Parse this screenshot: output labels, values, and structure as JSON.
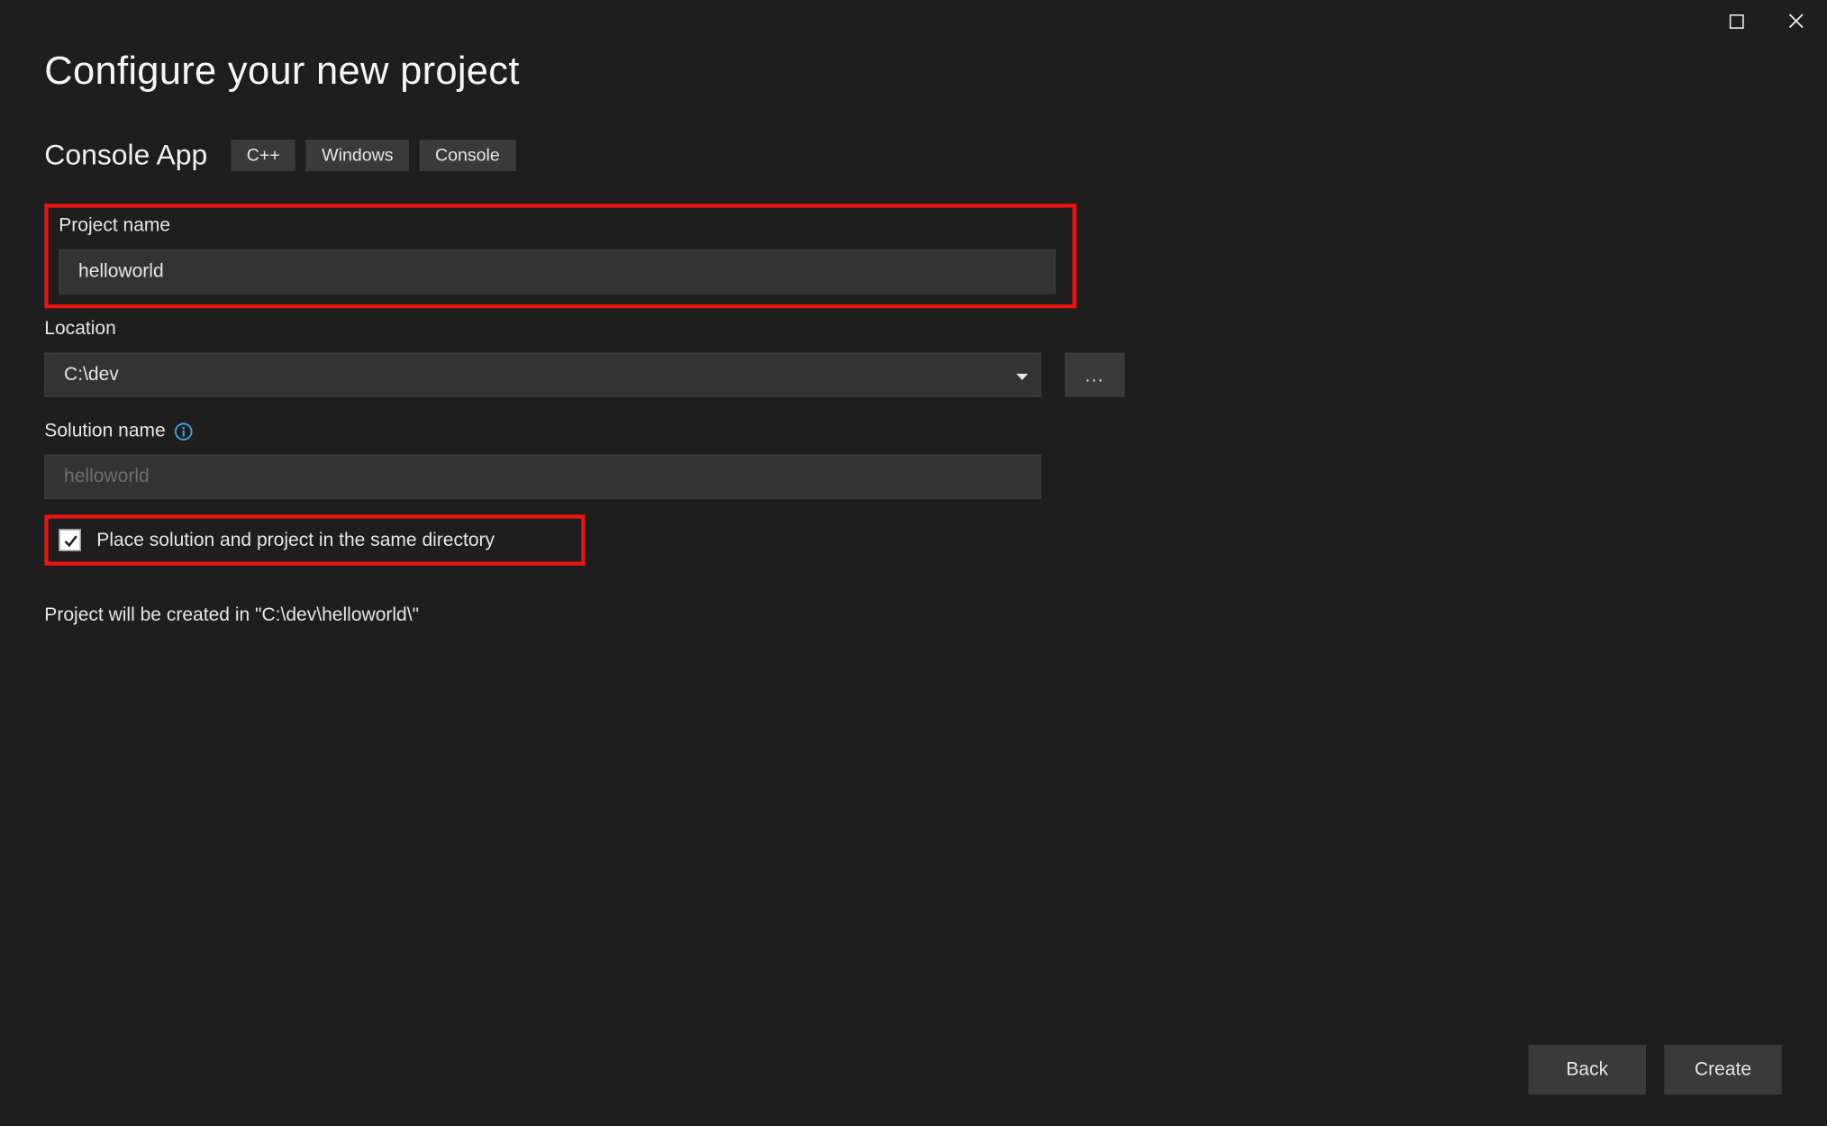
{
  "header": {
    "title": "Configure your new project",
    "template_name": "Console App",
    "tags": [
      "C++",
      "Windows",
      "Console"
    ]
  },
  "fields": {
    "project_name_label": "Project name",
    "project_name_value": "helloworld",
    "location_label": "Location",
    "location_value": "C:\\dev",
    "browse_label": "...",
    "solution_name_label": "Solution name",
    "solution_name_placeholder": "helloworld",
    "same_dir_label": "Place solution and project in the same directory",
    "same_dir_checked": true,
    "path_note": "Project will be created in \"C:\\dev\\helloworld\\\""
  },
  "footer": {
    "back_label": "Back",
    "create_label": "Create"
  }
}
